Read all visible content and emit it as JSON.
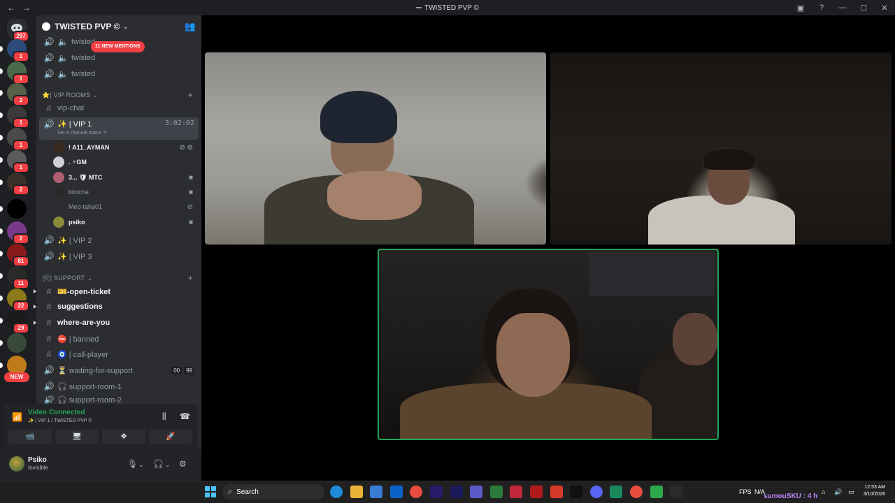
{
  "window": {
    "title": "TWISTED PVP",
    "nav_back": "←",
    "nav_forward": "→",
    "controls": [
      "▣",
      "?",
      "—",
      "☐",
      "✕"
    ]
  },
  "rail": {
    "home_badge": "297",
    "servers": [
      {
        "badge": "1",
        "color": "#2c4a7a"
      },
      {
        "badge": "1",
        "color": "#4a6a4a"
      },
      {
        "badge": "2",
        "color": "#556048"
      },
      {
        "badge": "1",
        "color": "#3a3a3a"
      },
      {
        "badge": "1",
        "color": "#4a4a4a"
      },
      {
        "badge": "1",
        "color": "#5a5a5a"
      },
      {
        "badge": "2",
        "color": "#3a3028"
      },
      {
        "badge": "",
        "color": "#000000"
      },
      {
        "badge": "2",
        "color": "#7a3a8a"
      },
      {
        "badge": "81",
        "color": "#8a1a1a"
      },
      {
        "badge": "11",
        "color": "#2a2a2a"
      },
      {
        "badge": "22",
        "color": "#8a7a1a"
      },
      {
        "badge": "29",
        "color": "#1a1a1a"
      },
      {
        "badge": "",
        "color": "#3a4a3a"
      },
      {
        "badge": "",
        "color": "#c07a1a"
      },
      {
        "badge": "",
        "color": "#5a1a1a"
      }
    ],
    "new_label": "NEW"
  },
  "guild": {
    "name": "TWISTED PVP ©"
  },
  "channels": {
    "mentions_pill": "11 NEW MENTIONS",
    "top_voice": [
      "twisted",
      "twisted",
      "twisted"
    ],
    "vip_category": "⭐| VIP ROOMS",
    "vip_chat": "vip-chat",
    "vip1": {
      "name": "✨ | VIP 1",
      "status": "Set a channel status",
      "timer": "3:02:02"
    },
    "vip1_users": [
      {
        "name": "! A11_AYMAN",
        "status": "⊘ ⊘",
        "avatar": "#3a2a20"
      },
      {
        "name": ". ⚡GM",
        "status": "",
        "avatar": "#d0d0d8"
      },
      {
        "name": "3... 🛡 MTC",
        "status": "■",
        "avatar": "#b06070"
      },
      {
        "name": "blotche",
        "status": "■",
        "avatar": "#2a2a2a"
      },
      {
        "name": "Med-taha01",
        "status": "⊘",
        "avatar": "#2b2d31"
      },
      {
        "name": "psiko",
        "status": "■",
        "avatar": "#8a8a3a"
      }
    ],
    "vip2": "✨ | VIP 2",
    "vip3": "✨ | VIP 3",
    "support_category": "🛠| SUPPORT",
    "support": [
      {
        "icon": "#",
        "name": "🎫-open-ticket",
        "bright": true
      },
      {
        "icon": "#",
        "name": "suggestions",
        "bright": true
      },
      {
        "icon": "#",
        "name": "where-are-you",
        "bright": true
      },
      {
        "icon": "#",
        "name": "⛔ | banned",
        "bright": false
      },
      {
        "icon": "#",
        "name": "🧿 | call-player",
        "bright": false
      },
      {
        "icon": "🔊",
        "name": "⏳ waiting-for-support",
        "bright": false,
        "counts": [
          "00",
          "99"
        ]
      },
      {
        "icon": "🔊",
        "name": "🎧 support-room-1",
        "bright": false
      },
      {
        "icon": "🔊",
        "name": "🎧 support-room-2",
        "bright": false
      }
    ]
  },
  "voice_panel": {
    "status": "Video Connected",
    "channel": "✨ | VIP 1 / TWISTED PVP ©",
    "buttons": [
      "📹",
      "🖥",
      "❖",
      "🚀"
    ]
  },
  "user": {
    "name": "Psiko",
    "status": "Invisible"
  },
  "taskbar": {
    "search_placeholder": "Search",
    "overlay_text": "sumouSKU : 4 h",
    "tray_fps": "FPS",
    "tray_na": "N/A",
    "time": "12:53 AM",
    "date": "3/10/2026",
    "apps": [
      {
        "name": "edge",
        "color": "#1f8ad6"
      },
      {
        "name": "explorer",
        "color": "#e8b339"
      },
      {
        "name": "store",
        "color": "#3a7bd5"
      },
      {
        "name": "outlook",
        "color": "#0a64c8"
      },
      {
        "name": "chrome",
        "color": "#e84c3d"
      },
      {
        "name": "premiere",
        "color": "#2a1a6a"
      },
      {
        "name": "after-effects",
        "color": "#1a1a5a"
      },
      {
        "name": "teams",
        "color": "#5a5ac8"
      },
      {
        "name": "xbox",
        "color": "#2a7a3a"
      },
      {
        "name": "affinity",
        "color": "#c0283a"
      },
      {
        "name": "app-red",
        "color": "#b01a1a"
      },
      {
        "name": "office",
        "color": "#d83a2a"
      },
      {
        "name": "tradingview",
        "color": "#111111"
      },
      {
        "name": "discord",
        "color": "#5865f2"
      },
      {
        "name": "app-green",
        "color": "#1a8a5a"
      },
      {
        "name": "chrome-2",
        "color": "#e84c3d"
      },
      {
        "name": "play",
        "color": "#2aa84a"
      },
      {
        "name": "app-dark",
        "color": "#2a2a2a"
      }
    ]
  }
}
